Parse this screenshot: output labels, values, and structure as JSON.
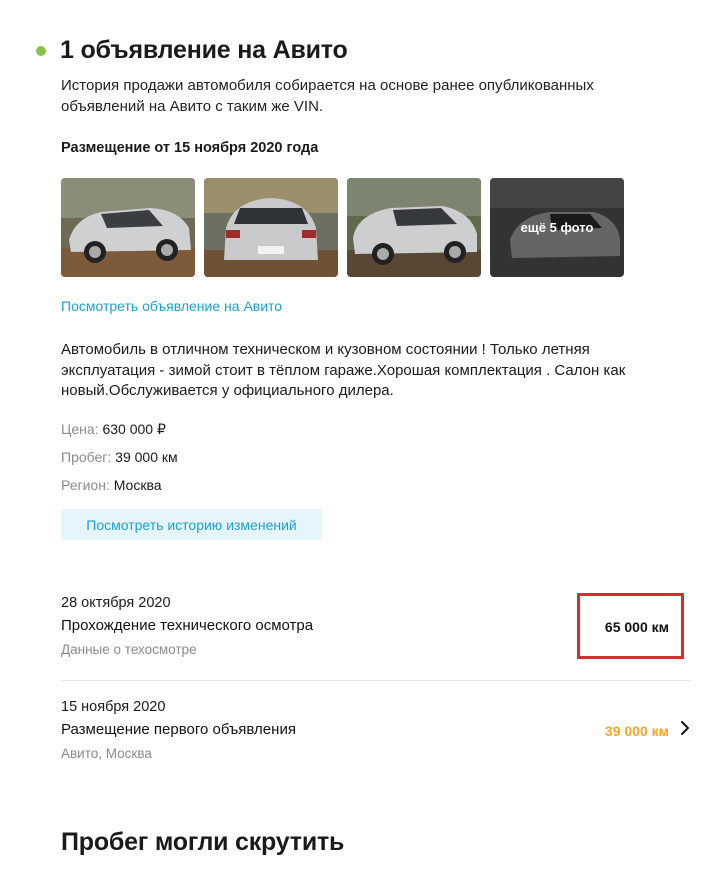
{
  "section": {
    "title": "1 объявление на Авито",
    "intro": "История продажи автомобиля собирается на основе ранее опубликованных объявлений на Авито с таким же VIN.",
    "accent_color": "#8bc34a"
  },
  "listing": {
    "heading": "Размещение от 15 ноября 2020 года",
    "more_photos": "ещё 5 фото",
    "view_link": "Посмотреть объявление на Авито",
    "description": "Автомобиль в отличном техническом и кузовном состоянии ! Только летняя эксплуатация - зимой стоит в тёплом гараже.Хорошая комплектация . Салон как новый.Обслуживается у официального дилера.",
    "price_label": "Цена:",
    "price_value": "630 000 ₽",
    "mileage_label": "Пробег:",
    "mileage_value": "39 000 км",
    "region_label": "Регион:",
    "region_value": "Москва",
    "history_button": "Посмотреть историю изменений"
  },
  "events": [
    {
      "date": "28 октября 2020",
      "title": "Прохождение технического осмотра",
      "subtitle": "Данные о техосмотре",
      "value": "65 000 км",
      "value_color": "#111111"
    },
    {
      "date": "15 ноября 2020",
      "title": "Размещение первого объявления",
      "subtitle": "Авито, Москва",
      "value": "39 000 км",
      "value_color": "#f5a623"
    }
  ],
  "bottom": {
    "title": "Пробег могли скрутить"
  },
  "colors": {
    "link": "#1a9fd6",
    "highlight": "#d32f2f"
  }
}
